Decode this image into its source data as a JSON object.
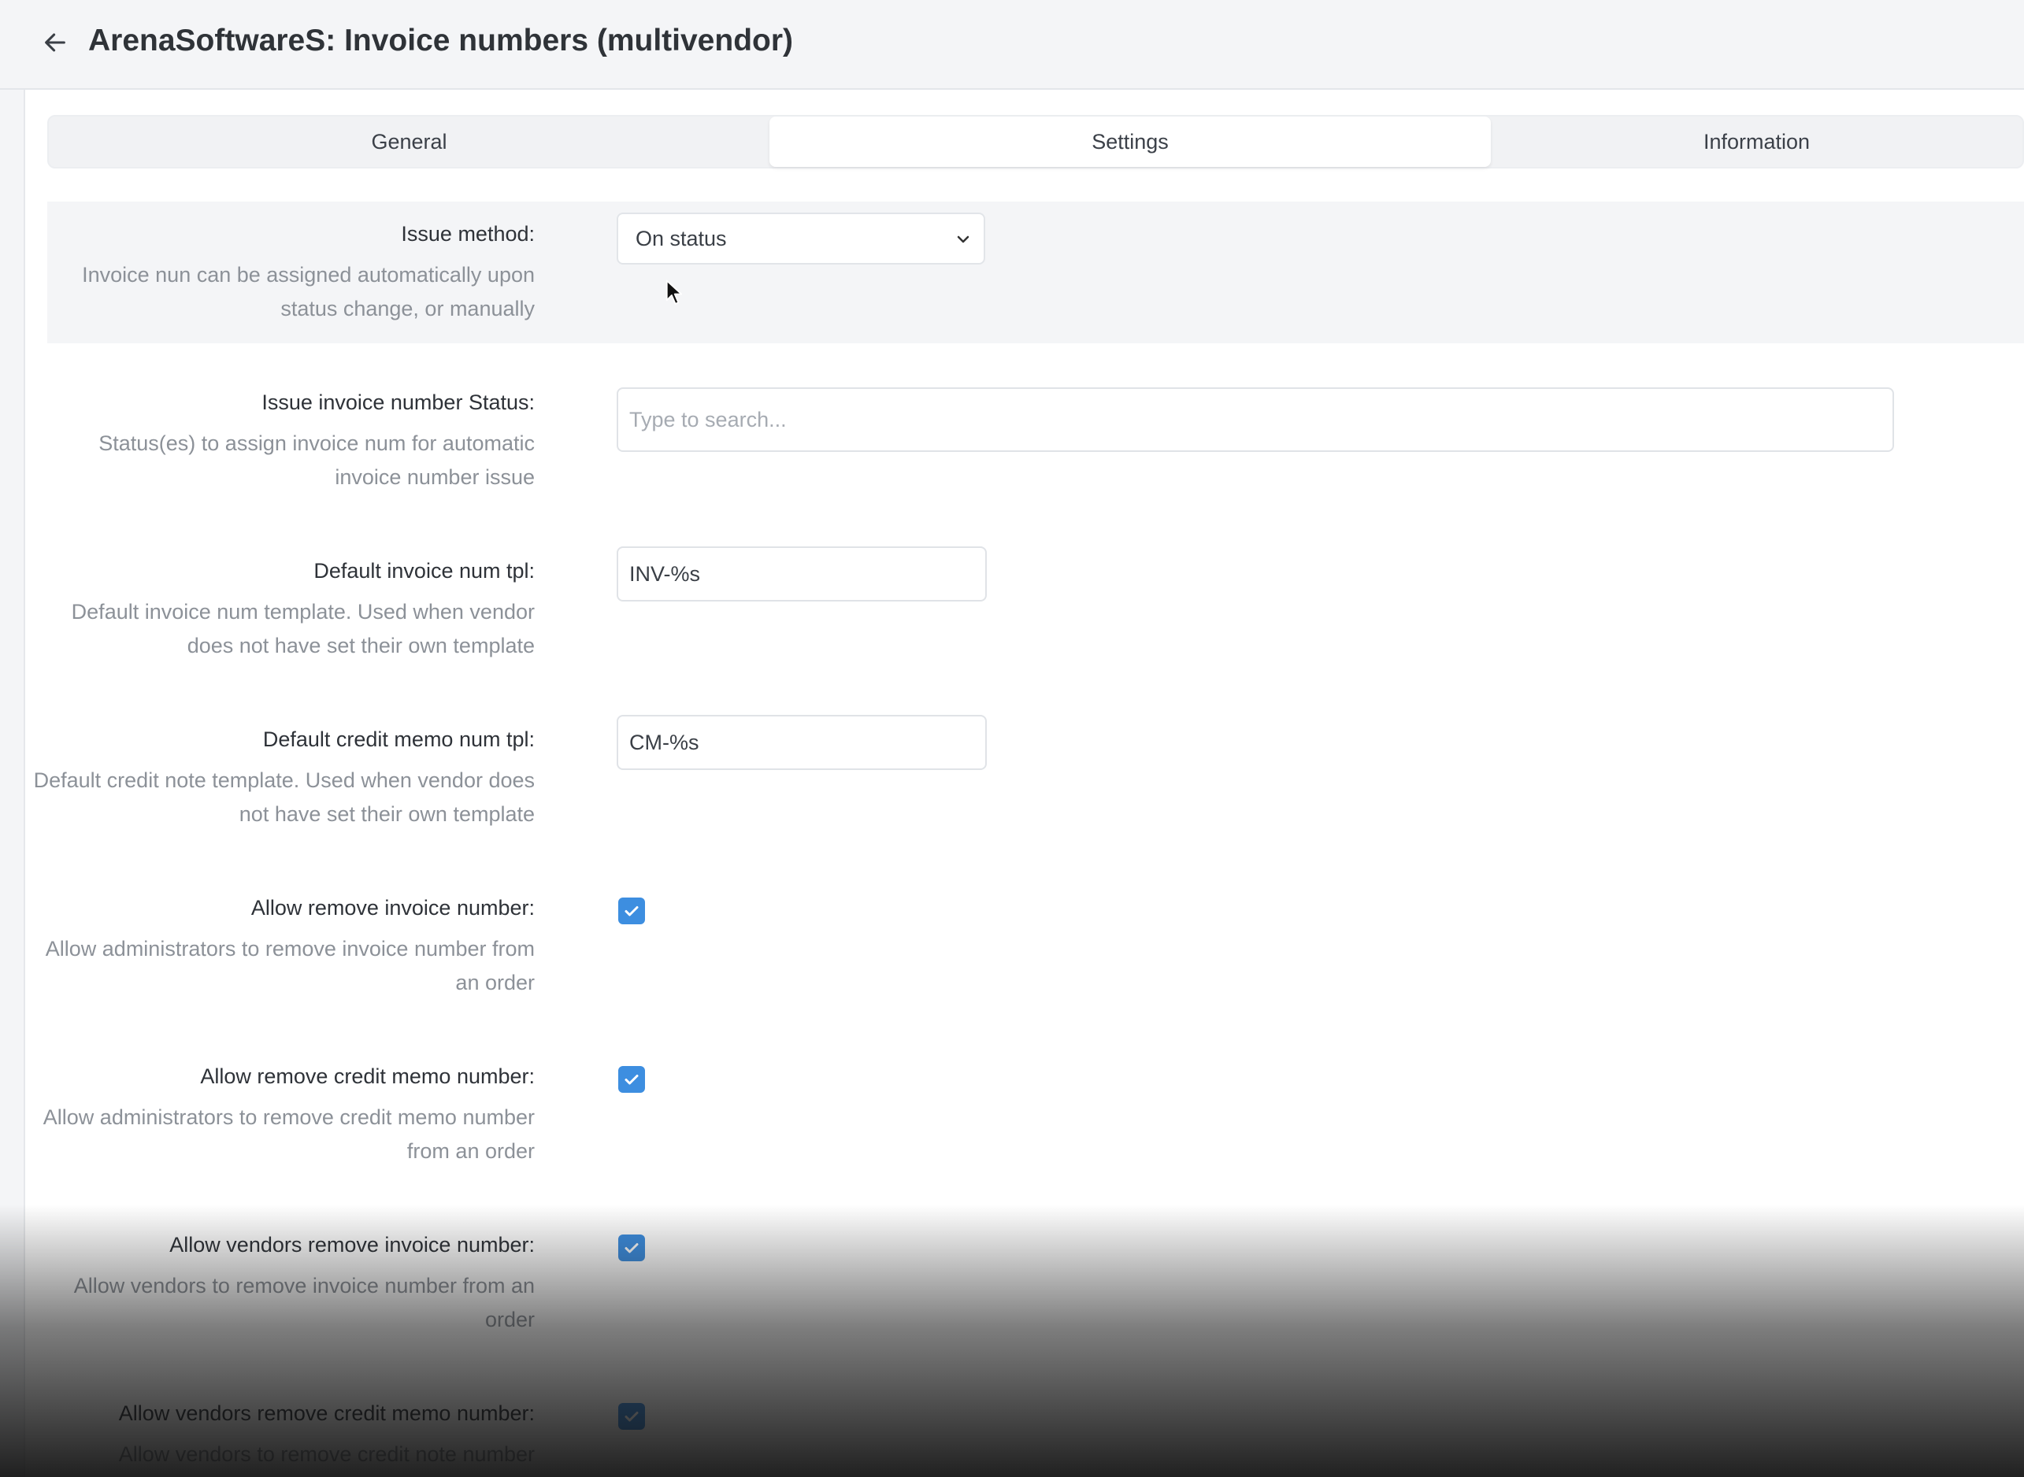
{
  "header": {
    "title": "ArenaSoftwareS: Invoice numbers (multivendor)",
    "back_icon": "arrow-left-icon"
  },
  "tabs": [
    {
      "label": "General",
      "active": false
    },
    {
      "label": "Settings",
      "active": true
    },
    {
      "label": "Information",
      "active": false
    }
  ],
  "settings": {
    "issue_method": {
      "label": "Issue method:",
      "description": "Invoice nun can be assigned automatically upon status change, or manually",
      "value": "On status"
    },
    "issue_status": {
      "label": "Issue invoice number Status:",
      "description": "Status(es) to assign invoice num for automatic invoice number issue",
      "placeholder": "Type to search..."
    },
    "invoice_tpl": {
      "label": "Default invoice num tpl:",
      "description": "Default invoice num template. Used when vendor does not have set their own template",
      "value": "INV-%s"
    },
    "credit_tpl": {
      "label": "Default credit memo num tpl:",
      "description": "Default credit note template. Used when vendor does not have set their own template",
      "value": "CM-%s"
    },
    "allow_remove_invoice": {
      "label": "Allow remove invoice number:",
      "description": "Allow administrators to remove invoice number from an order",
      "checked": true
    },
    "allow_remove_credit": {
      "label": "Allow remove credit memo number:",
      "description": "Allow administrators to remove credit memo number from an order",
      "checked": true
    },
    "vendors_remove_invoice": {
      "label": "Allow vendors remove invoice number:",
      "description": "Allow vendors to remove invoice number from an order",
      "checked": true
    },
    "vendors_remove_credit": {
      "label": "Allow vendors remove credit memo number:",
      "description": "Allow vendors to remove credit note number",
      "checked": true
    }
  },
  "colors": {
    "accent": "#3d8ee0",
    "background": "#f4f5f7"
  }
}
